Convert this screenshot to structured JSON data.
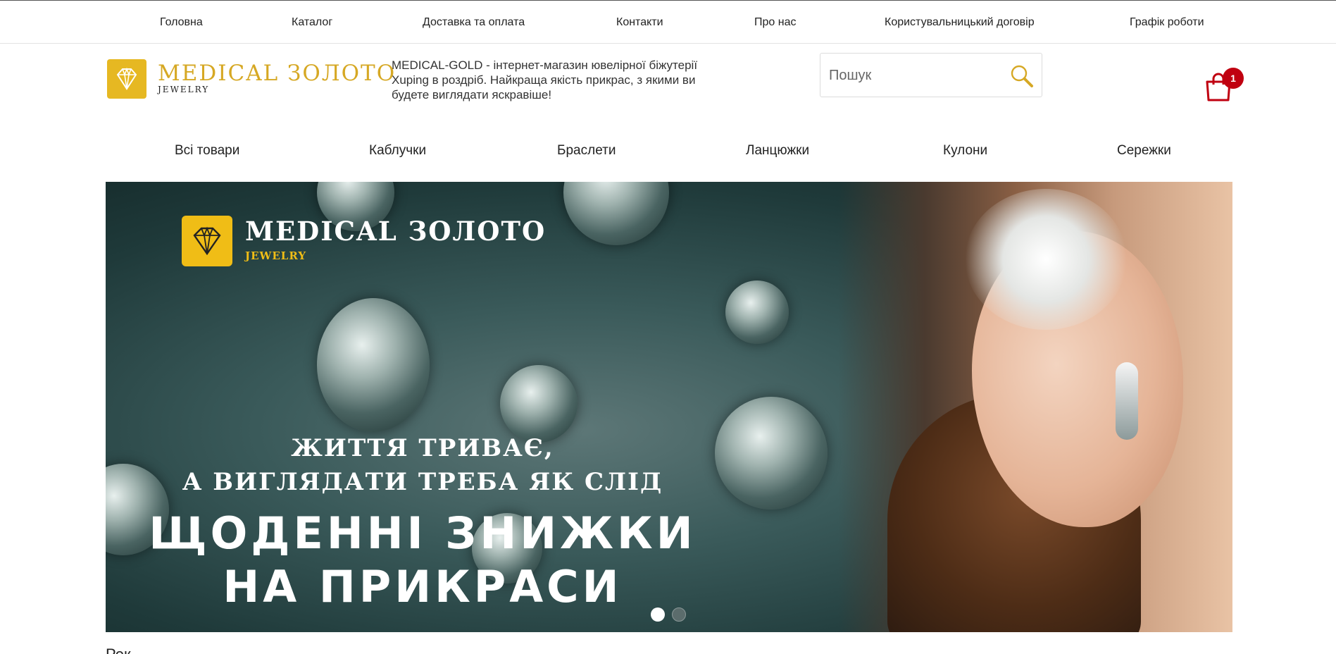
{
  "top_nav": {
    "items": [
      {
        "label": "Головна"
      },
      {
        "label": "Каталог"
      },
      {
        "label": "Доставка та оплата"
      },
      {
        "label": "Контакти"
      },
      {
        "label": "Про нас"
      },
      {
        "label": "Користувальницький договір"
      },
      {
        "label": "Графік роботи"
      }
    ]
  },
  "header": {
    "logo_title": "MEDICAL ЗОЛОТО",
    "logo_subtitle": "JEWELRY",
    "logo_icon": "diamond-icon",
    "tagline": "MEDICAL-GOLD - інтернет-магазин ювелірної біжутерії Xuping в роздріб. Найкраща якість прикрас, з якими ви будете виглядати яскравіше!",
    "search": {
      "placeholder": "Пошук",
      "value": "",
      "icon": "search-icon"
    },
    "cart": {
      "icon": "shopping-bag-icon",
      "count": "1"
    }
  },
  "category_nav": {
    "items": [
      {
        "label": "Всі товари"
      },
      {
        "label": "Каблучки"
      },
      {
        "label": "Браслети"
      },
      {
        "label": "Ланцюжки"
      },
      {
        "label": "Кулони"
      },
      {
        "label": "Сережки"
      }
    ]
  },
  "banner": {
    "logo_title": "MEDICAL ЗОЛОТО",
    "logo_subtitle": "JEWELRY",
    "line1": "ЖИТТЯ ТРИВАЄ,",
    "line2": "А ВИГЛЯДАТИ ТРЕБА ЯК СЛІД",
    "line3": "ЩОДЕННІ ЗНИЖКИ",
    "line4": "НА ПРИКРАСИ",
    "slides_total": 2,
    "active_slide": 1
  },
  "colors": {
    "brand_gold": "#d6a824",
    "banner_gold": "#f0bd16",
    "cart_red": "#c00010",
    "banner_dark": "#1f3a3a"
  },
  "below_banner_text": "Рек..."
}
